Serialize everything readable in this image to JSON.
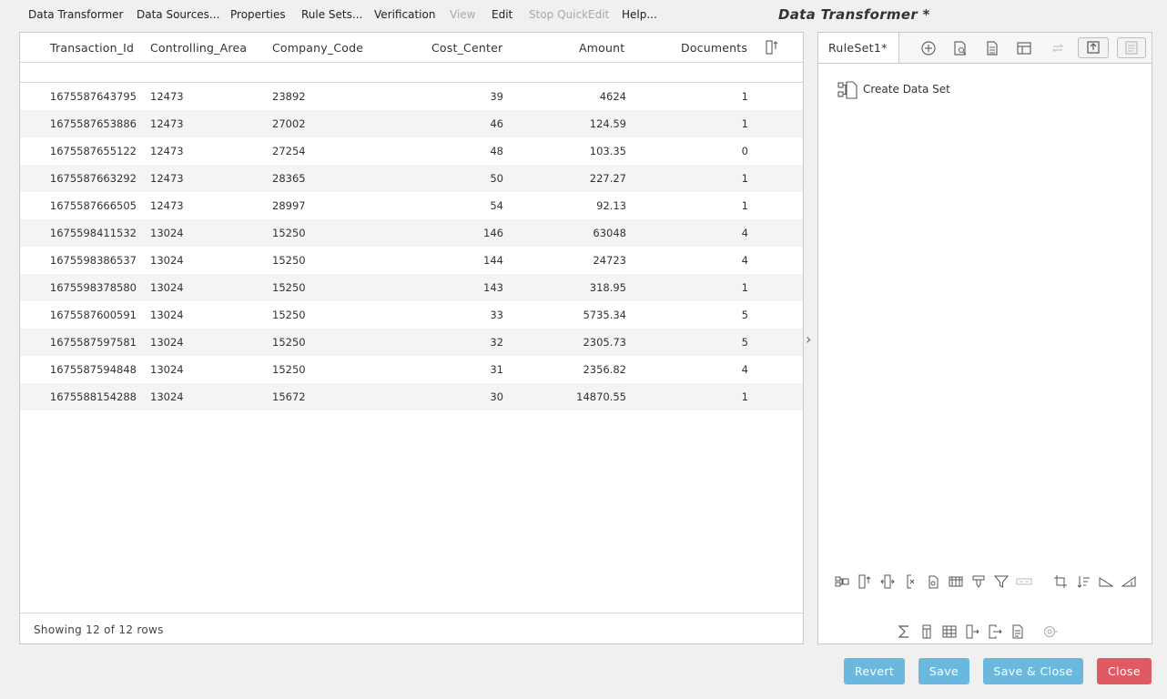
{
  "menu": {
    "items": [
      {
        "label": "Data Transformer",
        "enabled": true
      },
      {
        "label": "Data Sources...",
        "enabled": true
      },
      {
        "label": "Properties",
        "enabled": true
      },
      {
        "label": "Rule Sets...",
        "enabled": true
      },
      {
        "label": "Verification",
        "enabled": true
      },
      {
        "label": "View",
        "enabled": false
      },
      {
        "label": "Edit",
        "enabled": true
      },
      {
        "label": "Stop QuickEdit",
        "enabled": false
      },
      {
        "label": "Help...",
        "enabled": true
      }
    ],
    "title": "Data Transformer *"
  },
  "grid": {
    "columns": [
      "Transaction_Id",
      "Controlling_Area",
      "Company_Code",
      "Cost_Center",
      "Amount",
      "Documents"
    ],
    "rows": [
      [
        "1675587643795",
        "12473",
        "23892",
        "39",
        "4624",
        "1"
      ],
      [
        "1675587653886",
        "12473",
        "27002",
        "46",
        "124.59",
        "1"
      ],
      [
        "1675587655122",
        "12473",
        "27254",
        "48",
        "103.35",
        "0"
      ],
      [
        "1675587663292",
        "12473",
        "28365",
        "50",
        "227.27",
        "1"
      ],
      [
        "1675587666505",
        "12473",
        "28997",
        "54",
        "92.13",
        "1"
      ],
      [
        "1675598411532",
        "13024",
        "15250",
        "146",
        "63048",
        "4"
      ],
      [
        "1675598386537",
        "13024",
        "15250",
        "144",
        "24723",
        "4"
      ],
      [
        "1675598378580",
        "13024",
        "15250",
        "143",
        "318.95",
        "1"
      ],
      [
        "1675587600591",
        "13024",
        "15250",
        "33",
        "5735.34",
        "5"
      ],
      [
        "1675587597581",
        "13024",
        "15250",
        "32",
        "2305.73",
        "5"
      ],
      [
        "1675587594848",
        "13024",
        "15250",
        "31",
        "2356.82",
        "4"
      ],
      [
        "1675588154288",
        "13024",
        "15672",
        "30",
        "14870.55",
        "1"
      ]
    ],
    "footer": "Showing 12 of 12 rows"
  },
  "rules": {
    "tab_label": "RuleSet1*",
    "create_label": "Create Data Set"
  },
  "buttons": {
    "revert": "Revert",
    "save": "Save",
    "save_close": "Save & Close",
    "close": "Close"
  },
  "colors": {
    "accent": "#6bb8df",
    "danger": "#e05a63",
    "row_alt": "#f2f4f5"
  }
}
